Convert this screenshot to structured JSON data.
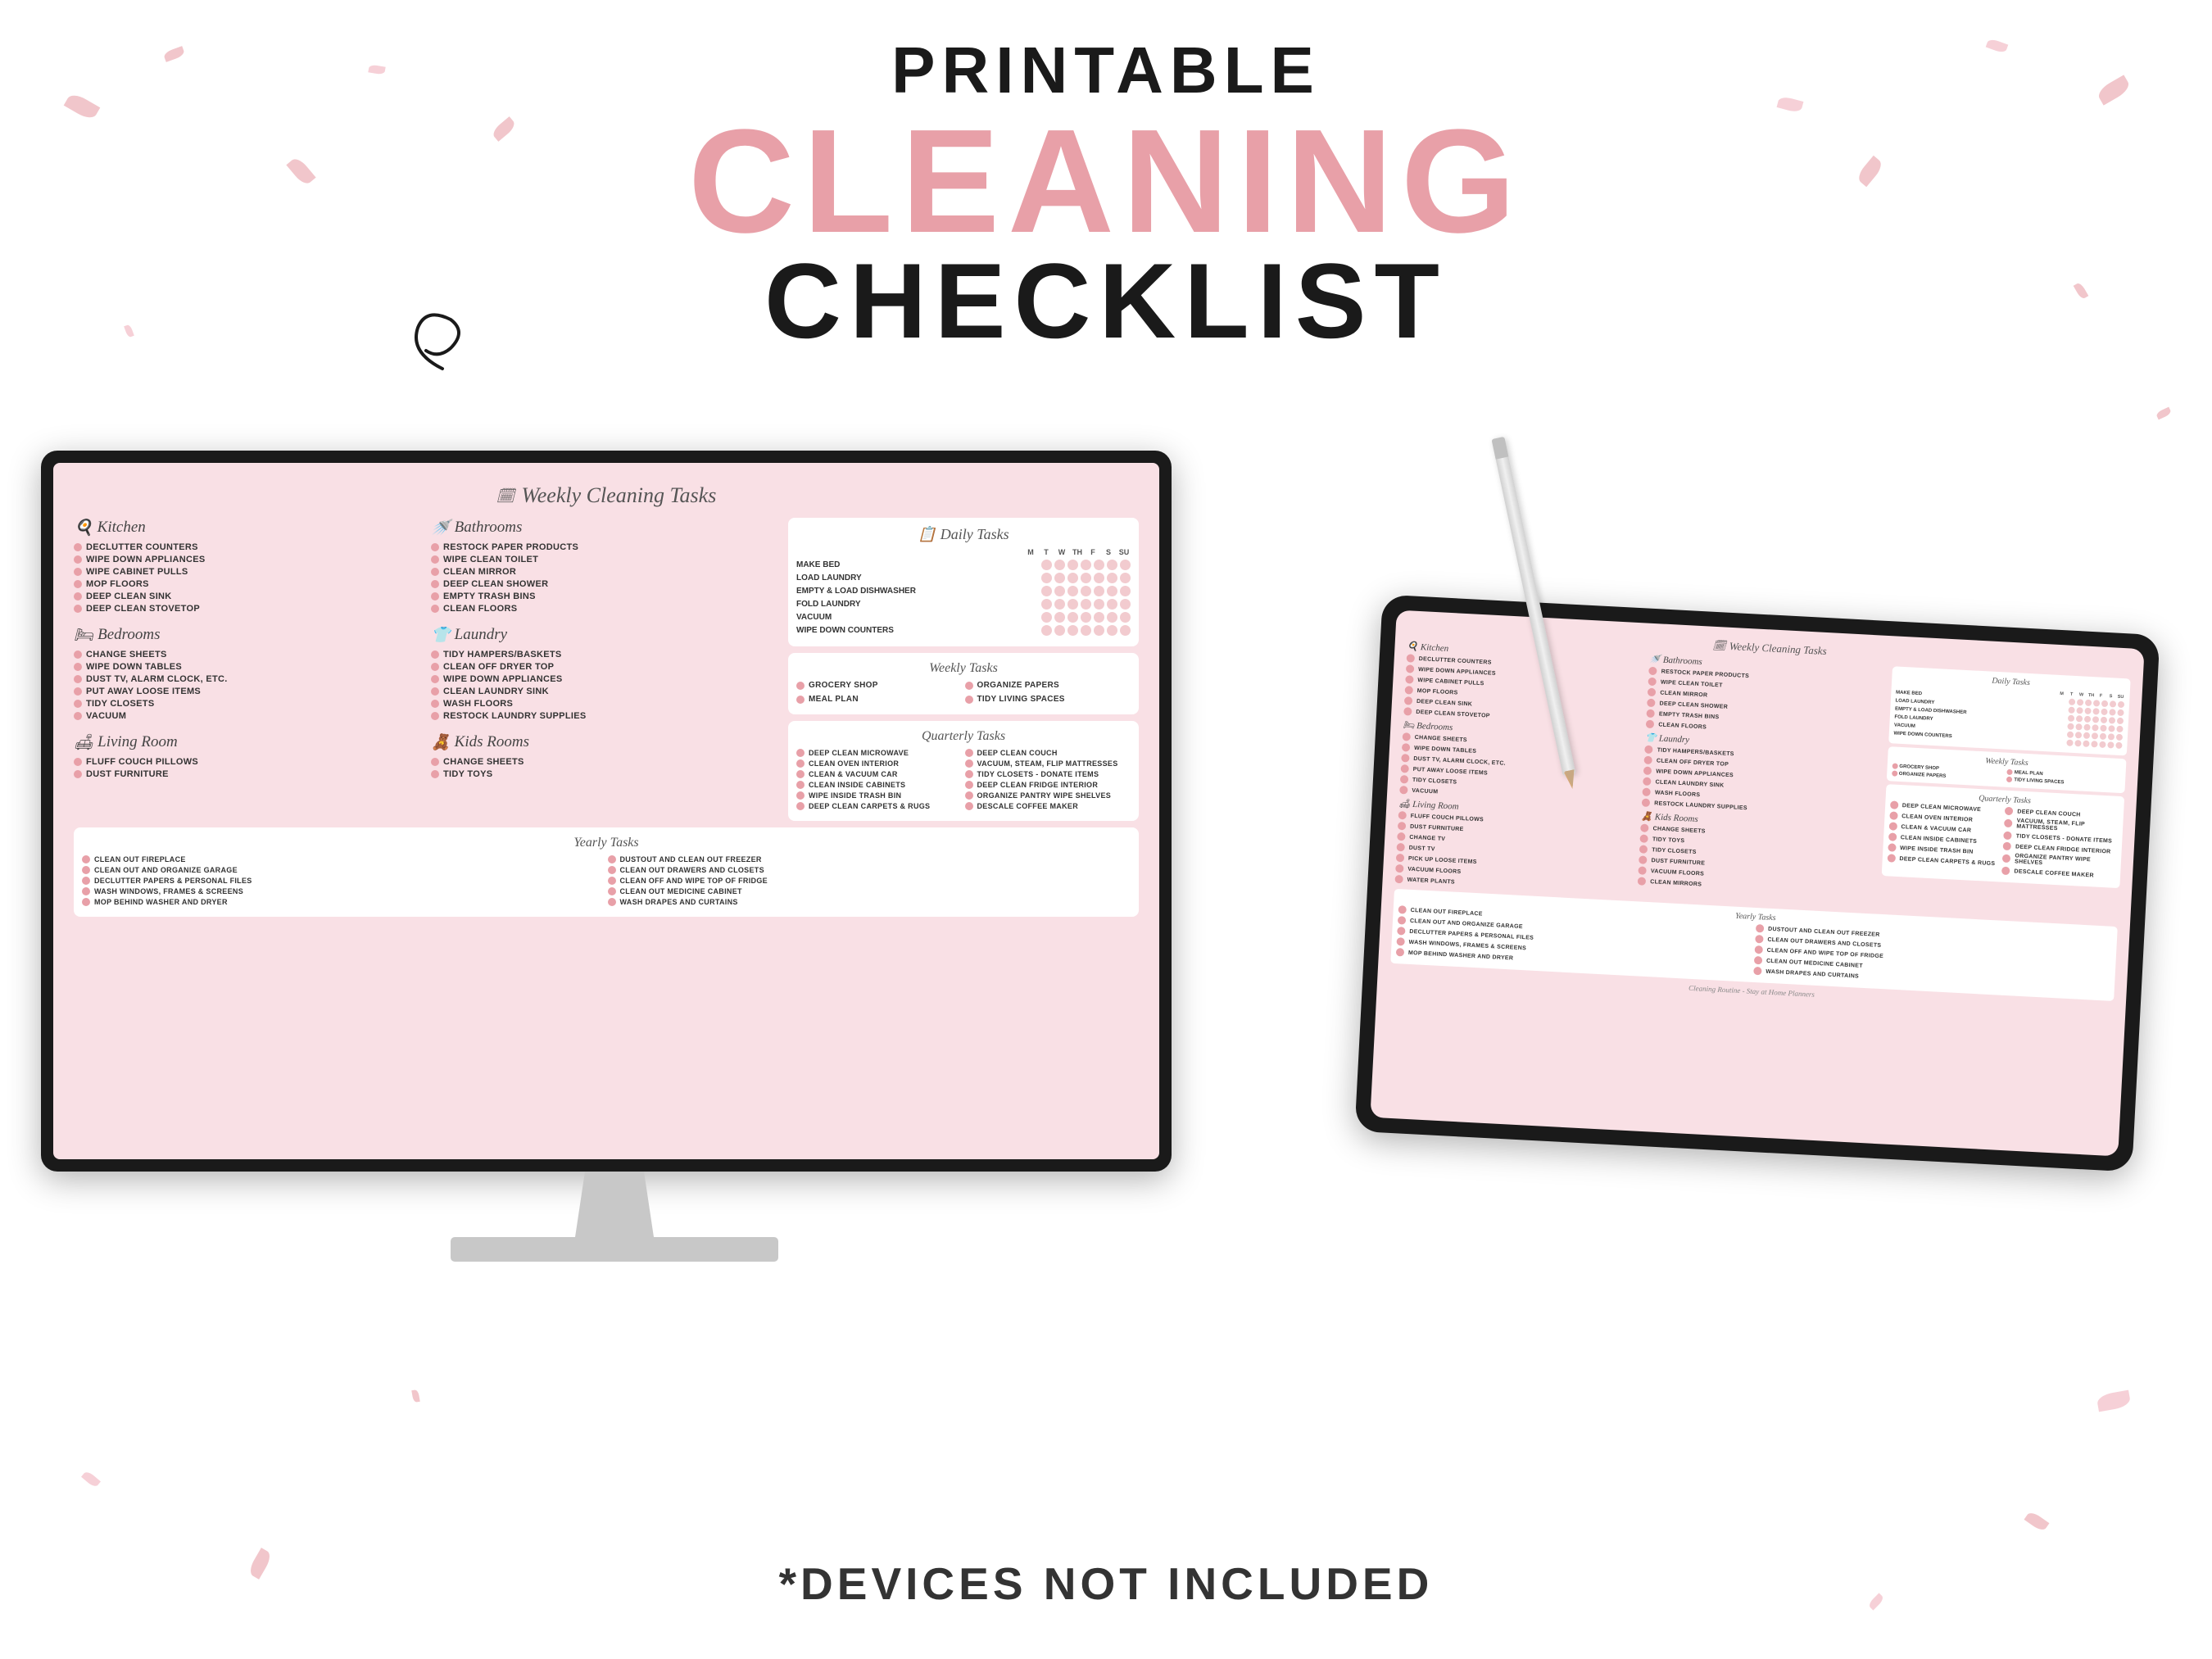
{
  "header": {
    "printable": "PRINTABLE",
    "cleaning": "CLEANING",
    "checklist": "CHECKLIST"
  },
  "footer": {
    "text": "*DEVICES NOT INCLUDED"
  },
  "document": {
    "title": "Weekly Cleaning Tasks",
    "daily_title": "Daily Tasks",
    "weekly_tasks_title": "Weekly Tasks",
    "quarterly_title": "Quarterly Tasks",
    "yearly_title": "Yearly Tasks",
    "sections": {
      "kitchen": {
        "label": "Kitchen",
        "items": [
          "DECLUTTER COUNTERS",
          "WIPE DOWN APPLIANCES",
          "WIPE CABINET PULLS",
          "MOP FLOORS",
          "DEEP CLEAN SINK",
          "DEEP CLEAN STOVETOP"
        ]
      },
      "bathrooms_left": {
        "label": "Bathrooms",
        "items": [
          "RESTOCK PAPER PRODUCTS",
          "WIPE CLEAN TOILET",
          "CLEAN MIRROR",
          "DEEP CLEAN SHOWER",
          "EMPTY TRASH BINS",
          "CLEAN FLOORS"
        ]
      },
      "bedrooms": {
        "label": "Bedrooms",
        "items": [
          "CHANGE SHEETS",
          "WIPE DOWN TABLES",
          "DUST TV, ALARM CLOCK, ETC.",
          "PUT AWAY LOOSE ITEMS",
          "TIDY CLOSETS",
          "VACUUM"
        ]
      },
      "laundry": {
        "label": "Laundry",
        "items": [
          "TIDY HAMPERS/BASKETS",
          "CLEAN OFF DRYER TOP",
          "WIPE DOWN APPLIANCES",
          "CLEAN LAUNDRY SINK",
          "WASH FLOORS",
          "RESTOCK LAUNDRY SUPPLIES"
        ]
      },
      "living_room": {
        "label": "Living Room",
        "items": [
          "FLUFF COUCH PILLOWS",
          "DUST FURNITURE"
        ]
      },
      "kids_rooms": {
        "label": "Kids Rooms",
        "items": [
          "CHANGE SHEETS",
          "TIDY TOYS"
        ]
      }
    },
    "daily_tasks": {
      "items": [
        "MAKE BED",
        "LOAD LAUNDRY",
        "EMPTY & LOAD DISHWASHER",
        "FOLD LAUNDRY",
        "VACUUM",
        "WIPE DOWN COUNTERS"
      ],
      "days": [
        "M",
        "T",
        "W",
        "TH",
        "F",
        "S",
        "SU"
      ]
    },
    "weekly_tasks": {
      "items": [
        "GROCERY SHOP",
        "ORGANIZE PAPERS",
        "MEAL PLAN",
        "TIDY LIVING SPACES"
      ]
    },
    "quarterly_tasks": {
      "left": [
        "DEEP CLEAN MICROWAVE",
        "CLEAN OVEN INTERIOR",
        "CLEAN & VACUUM CAR",
        "CLEAN INSIDE CABINETS",
        "WIPE INSIDE TRASH BIN",
        "DEEP CLEAN CARPETS & RUGS"
      ],
      "right": [
        "DEEP CLEAN COUCH",
        "VACUUM, STEAM, FLIP MATTRESSES",
        "TIDY CLOSETS - DONATE ITEMS",
        "DEEP CLEAN FRIDGE INTERIOR",
        "ORGANIZE PANTRY WIPE SHELVES",
        "DESCALE COFFEE MAKER"
      ]
    },
    "yearly_tasks": {
      "left": [
        "CLEAN OUT FIREPLACE",
        "CLEAN OUT AND ORGANIZE GARAGE",
        "DECLUTTER PAPERS & PERSONAL FILES",
        "WASH WINDOWS, FRAMES & SCREENS",
        "MOP BEHIND WASHER AND DRYER"
      ],
      "right": [
        "DUSTOUT AND CLEAN OUT FREEZER",
        "CLEAN OUT DRAWERS AND CLOSETS",
        "CLEAN OFF AND WIPE TOP OF FRIDGE",
        "CLEAN OUT MEDICINE CABINET",
        "WASH DRAPES AND CURTAINS"
      ]
    }
  }
}
